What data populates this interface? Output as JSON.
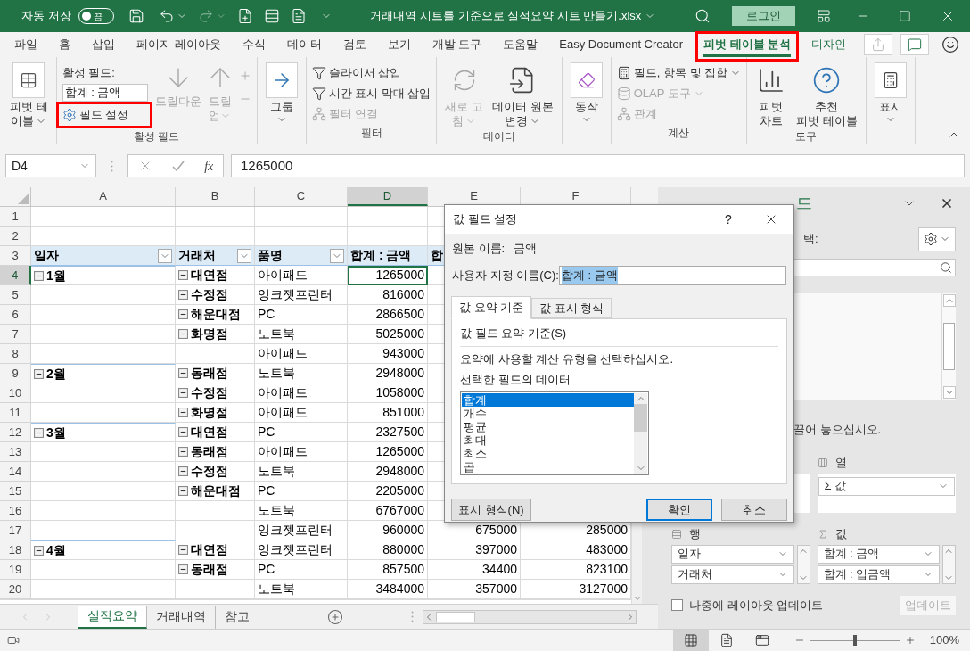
{
  "title_bar": {
    "autosave_label": "자동 저장",
    "autosave_toggle": {
      "label": "끔",
      "on": false
    },
    "file_title": "거래내역 시트를 기준으로 실적요약 시트 만들기.xlsx",
    "login_button": "로그인"
  },
  "menu_tabs": [
    {
      "label": "파일",
      "selected": false,
      "contextual": false,
      "highlighted": false
    },
    {
      "label": "홈",
      "selected": false,
      "contextual": false,
      "highlighted": false
    },
    {
      "label": "삽입",
      "selected": false,
      "contextual": false,
      "highlighted": false
    },
    {
      "label": "페이지 레이아웃",
      "selected": false,
      "contextual": false,
      "highlighted": false
    },
    {
      "label": "수식",
      "selected": false,
      "contextual": false,
      "highlighted": false
    },
    {
      "label": "데이터",
      "selected": false,
      "contextual": false,
      "highlighted": false
    },
    {
      "label": "검토",
      "selected": false,
      "contextual": false,
      "highlighted": false
    },
    {
      "label": "보기",
      "selected": false,
      "contextual": false,
      "highlighted": false
    },
    {
      "label": "개발 도구",
      "selected": false,
      "contextual": false,
      "highlighted": false
    },
    {
      "label": "도움말",
      "selected": false,
      "contextual": false,
      "highlighted": false
    },
    {
      "label": "Easy Document Creator",
      "selected": false,
      "contextual": false,
      "highlighted": false
    },
    {
      "label": "피벗 테이블 분석",
      "selected": true,
      "contextual": true,
      "highlighted": true
    },
    {
      "label": "디자인",
      "selected": false,
      "contextual": true,
      "highlighted": false
    }
  ],
  "ribbon": {
    "pivot_table": {
      "lines": [
        "피벗 테",
        "이블"
      ]
    },
    "active_field": {
      "label": "활성 필드:",
      "value": "합계 : 금액",
      "settings_button": {
        "label": "필드 설정",
        "highlighted": true
      },
      "drill_down": {
        "label": "드릴다운",
        "disabled": true
      },
      "drill_up": {
        "lines": [
          "드릴",
          "업"
        ],
        "disabled": true
      },
      "group_label": "활성 필드"
    },
    "group_button": {
      "label": "그룹"
    },
    "filter": {
      "items": [
        {
          "label": "슬라이서 삽입",
          "disabled": false
        },
        {
          "label": "시간 표시 막대 삽입",
          "disabled": false
        },
        {
          "label": "필터 연결",
          "disabled": true
        }
      ],
      "group_label": "필터"
    },
    "data": {
      "refresh": {
        "lines": [
          "새로 고",
          "침"
        ],
        "disabled": true
      },
      "change_source": {
        "lines": [
          "데이터 원본",
          "변경"
        ],
        "disabled": false
      },
      "group_label": "데이터"
    },
    "actions": {
      "label": "동작"
    },
    "calculations": {
      "items": [
        {
          "label": "필드, 항목 및 집합",
          "disabled": false
        },
        {
          "label": "OLAP 도구",
          "disabled": true
        },
        {
          "label": "관계",
          "disabled": true
        }
      ],
      "group_label": "계산"
    },
    "tools": {
      "items": [
        {
          "lines": [
            "피벗",
            "차트"
          ]
        },
        {
          "lines": [
            "추천",
            "피벗 테이블"
          ]
        }
      ],
      "group_label": "도구"
    },
    "show": {
      "label": "표시"
    }
  },
  "formula_bar": {
    "name_box": "D4",
    "function_label": "fx",
    "formula": "1265000"
  },
  "sheet": {
    "columns": [
      {
        "label": "A",
        "selected": false
      },
      {
        "label": "B",
        "selected": false
      },
      {
        "label": "C",
        "selected": false
      },
      {
        "label": "D",
        "selected": true
      },
      {
        "label": "E",
        "selected": false
      },
      {
        "label": "F",
        "selected": false
      }
    ],
    "rows": [
      {
        "number": "1",
        "selected": false,
        "kind": "data"
      },
      {
        "number": "2",
        "selected": false,
        "kind": "data"
      },
      {
        "number": "3",
        "selected": false,
        "kind": "header",
        "headers": [
          {
            "text": "일자",
            "filter": true
          },
          {
            "text": "거래처",
            "filter": true
          },
          {
            "text": "품명",
            "filter": true
          },
          {
            "text": "합계 : 금액"
          },
          {
            "text": "합"
          }
        ]
      },
      {
        "number": "4",
        "selected": true,
        "kind": "data",
        "a": "1월",
        "b": "대연점",
        "c": "아이패드",
        "d": "1265000"
      },
      {
        "number": "5",
        "selected": false,
        "kind": "data",
        "b": "수정점",
        "c": "잉크젯프린터",
        "d": "816000"
      },
      {
        "number": "6",
        "selected": false,
        "kind": "data",
        "b": "해운대점",
        "c": "PC",
        "d": "2866500"
      },
      {
        "number": "7",
        "selected": false,
        "kind": "data",
        "b": "화명점",
        "c": "노트북",
        "d": "5025000"
      },
      {
        "number": "8",
        "selected": false,
        "kind": "data",
        "c": "아이패드",
        "d": "943000"
      },
      {
        "number": "9",
        "selected": false,
        "kind": "data",
        "a": "2월",
        "b": "동래점",
        "c": "노트북",
        "d": "2948000"
      },
      {
        "number": "10",
        "selected": false,
        "kind": "data",
        "b": "수정점",
        "c": "아이패드",
        "d": "1058000"
      },
      {
        "number": "11",
        "selected": false,
        "kind": "data",
        "b": "화명점",
        "c": "아이패드",
        "d": "851000"
      },
      {
        "number": "12",
        "selected": false,
        "kind": "data",
        "a": "3월",
        "b": "대연점",
        "c": "PC",
        "d": "2327500"
      },
      {
        "number": "13",
        "selected": false,
        "kind": "data",
        "b": "동래점",
        "c": "아이패드",
        "d": "1265000"
      },
      {
        "number": "14",
        "selected": false,
        "kind": "data",
        "b": "수정점",
        "c": "노트북",
        "d": "2948000"
      },
      {
        "number": "15",
        "selected": false,
        "kind": "data",
        "b": "해운대점",
        "c": "PC",
        "d": "2205000"
      },
      {
        "number": "16",
        "selected": false,
        "kind": "data",
        "c": "노트북",
        "d": "6767000"
      },
      {
        "number": "17",
        "selected": false,
        "kind": "data",
        "c": "잉크젯프린터",
        "d": "960000",
        "e": "675000",
        "f": "285000"
      },
      {
        "number": "18",
        "selected": false,
        "kind": "data",
        "a": "4월",
        "b": "대연점",
        "c": "잉크젯프린터",
        "d": "880000",
        "e": "397000",
        "f": "483000"
      },
      {
        "number": "19",
        "selected": false,
        "kind": "data",
        "b": "동래점",
        "c": "PC",
        "d": "857500",
        "e": "34400",
        "f": "823100"
      },
      {
        "number": "20",
        "selected": false,
        "kind": "data",
        "c": "노트북",
        "d": "3484000",
        "e": "357000",
        "f": "3127000"
      }
    ]
  },
  "sheet_tabs": [
    {
      "label": "실적요약",
      "selected": true
    },
    {
      "label": "거래내역",
      "selected": false
    },
    {
      "label": "참고",
      "selected": false
    }
  ],
  "dialog": {
    "title": "값 필드 설정",
    "help": "?",
    "source_label": "원본 이름:",
    "source_value": "금액",
    "custom_name_label": "사용자 지정 이름(C):",
    "custom_name_value": "합계 : 금액",
    "tabs": [
      {
        "label": "값 요약 기준",
        "selected": true
      },
      {
        "label": "값 표시 형식",
        "selected": false
      }
    ],
    "section_title": "값 필드 요약 기준(S)",
    "instruction": "요약에 사용할 계산 유형을 선택하십시오.",
    "list_label": "선택한 필드의 데이터",
    "functions": [
      {
        "label": "합계",
        "selected": true
      },
      {
        "label": "개수",
        "selected": false
      },
      {
        "label": "평균",
        "selected": false
      },
      {
        "label": "최대",
        "selected": false
      },
      {
        "label": "최소",
        "selected": false
      },
      {
        "label": "곱",
        "selected": false
      }
    ],
    "number_format_button": "표시 형식(N)",
    "ok_button": "확인",
    "cancel_button": "취소"
  },
  "field_pane": {
    "title_fragment": "드",
    "choose_label_fragment": "택:",
    "drag_hint_fragment": "끌어 놓으십시오.",
    "columns_area": {
      "label": "열",
      "items": [
        "Σ 값"
      ]
    },
    "rows_area": {
      "label": "행",
      "items": [
        "일자",
        "거래처"
      ]
    },
    "values_area": {
      "label": "값",
      "items": [
        "합계 : 금액",
        "합계 : 입금액"
      ]
    },
    "defer_update": {
      "label": "나중에 레이아웃 업데이트",
      "checked": false
    },
    "update_button": {
      "label": "업데이트",
      "disabled": true
    }
  },
  "status_bar": {
    "views": [
      {
        "selected": true
      },
      {
        "selected": false
      },
      {
        "selected": false
      }
    ],
    "zoom_slider": {
      "level": 0.5
    },
    "zoom_label": "100%"
  }
}
